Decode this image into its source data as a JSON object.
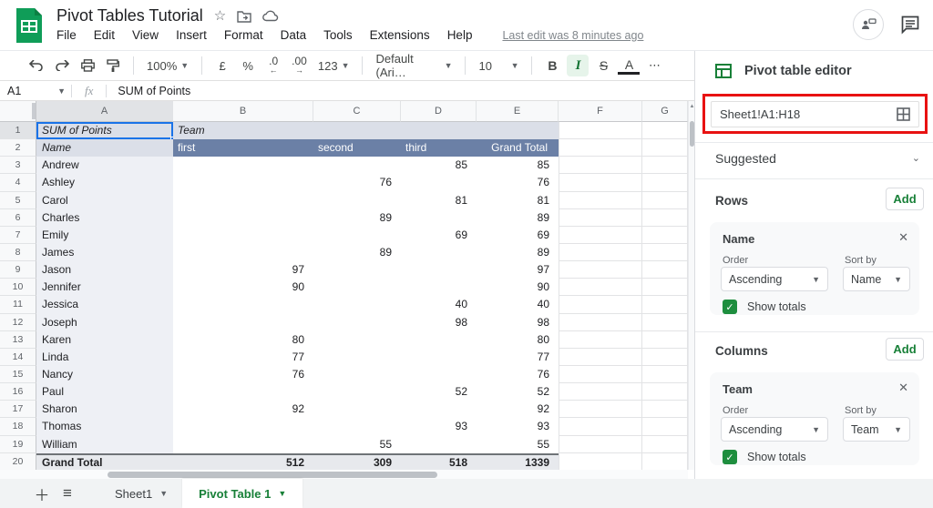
{
  "header": {
    "title": "Pivot Tables Tutorial",
    "menu": [
      "File",
      "Edit",
      "View",
      "Insert",
      "Format",
      "Data",
      "Tools",
      "Extensions",
      "Help"
    ],
    "last_edit": "Last edit was 8 minutes ago"
  },
  "toolbar": {
    "zoom": "100%",
    "currency": "£",
    "percent": "%",
    "decrease_decimal": ".0",
    "increase_decimal": ".00",
    "more_formats": "123",
    "font": "Default (Ari…",
    "font_size": "10",
    "bold": "B",
    "italic": "I",
    "strikethrough": "S",
    "text_color": "A",
    "more": "⋯"
  },
  "formula_bar": {
    "name_box": "A1",
    "fx": "fx",
    "content": "SUM of Points"
  },
  "grid": {
    "column_letters": [
      "A",
      "B",
      "C",
      "D",
      "E",
      "F",
      "G"
    ],
    "pivot": {
      "title_cell": "SUM of Points",
      "group_cell": "Team",
      "row_label": "Name",
      "column_headers": [
        "first",
        "second",
        "third",
        "Grand Total"
      ],
      "rows": [
        {
          "name": "Andrew",
          "first": null,
          "second": null,
          "third": 85,
          "total": 85
        },
        {
          "name": "Ashley",
          "first": null,
          "second": 76,
          "third": null,
          "total": 76
        },
        {
          "name": "Carol",
          "first": null,
          "second": null,
          "third": 81,
          "total": 81
        },
        {
          "name": "Charles",
          "first": null,
          "second": 89,
          "third": null,
          "total": 89
        },
        {
          "name": "Emily",
          "first": null,
          "second": null,
          "third": 69,
          "total": 69
        },
        {
          "name": "James",
          "first": null,
          "second": 89,
          "third": null,
          "total": 89
        },
        {
          "name": "Jason",
          "first": 97,
          "second": null,
          "third": null,
          "total": 97
        },
        {
          "name": "Jennifer",
          "first": 90,
          "second": null,
          "third": null,
          "total": 90
        },
        {
          "name": "Jessica",
          "first": null,
          "second": null,
          "third": 40,
          "total": 40
        },
        {
          "name": "Joseph",
          "first": null,
          "second": null,
          "third": 98,
          "total": 98
        },
        {
          "name": "Karen",
          "first": 80,
          "second": null,
          "third": null,
          "total": 80
        },
        {
          "name": "Linda",
          "first": 77,
          "second": null,
          "third": null,
          "total": 77
        },
        {
          "name": "Nancy",
          "first": 76,
          "second": null,
          "third": null,
          "total": 76
        },
        {
          "name": "Paul",
          "first": null,
          "second": null,
          "third": 52,
          "total": 52
        },
        {
          "name": "Sharon",
          "first": 92,
          "second": null,
          "third": null,
          "total": 92
        },
        {
          "name": "Thomas",
          "first": null,
          "second": null,
          "third": 93,
          "total": 93
        },
        {
          "name": "William",
          "first": null,
          "second": 55,
          "third": null,
          "total": 55
        }
      ],
      "grand_total": {
        "label": "Grand Total",
        "first": 512,
        "second": 309,
        "third": 518,
        "total": 1339
      }
    }
  },
  "panel": {
    "title": "Pivot table editor",
    "range": "Sheet1!A1:H18",
    "suggested": "Suggested",
    "rows_section": {
      "label": "Rows",
      "add": "Add",
      "card": {
        "title": "Name",
        "order_label": "Order",
        "order": "Ascending",
        "sort_label": "Sort by",
        "sort": "Name",
        "show_totals": "Show totals"
      }
    },
    "columns_section": {
      "label": "Columns",
      "add": "Add",
      "card": {
        "title": "Team",
        "order_label": "Order",
        "order": "Ascending",
        "sort_label": "Sort by",
        "sort": "Team",
        "show_totals": "Show totals"
      }
    }
  },
  "tabbar": {
    "sheet_tab": "Sheet1",
    "active_tab": "Pivot Table 1"
  },
  "colors": {
    "accent_green": "#188038",
    "logo_green": "#0f9d58",
    "pivot_header_blue": "#6b80a6",
    "pivot_light": "#dbdfe8",
    "selection_blue": "#1a73e8",
    "annotation_red": "#e81212",
    "total_row_gray": "#e7e9ed"
  }
}
